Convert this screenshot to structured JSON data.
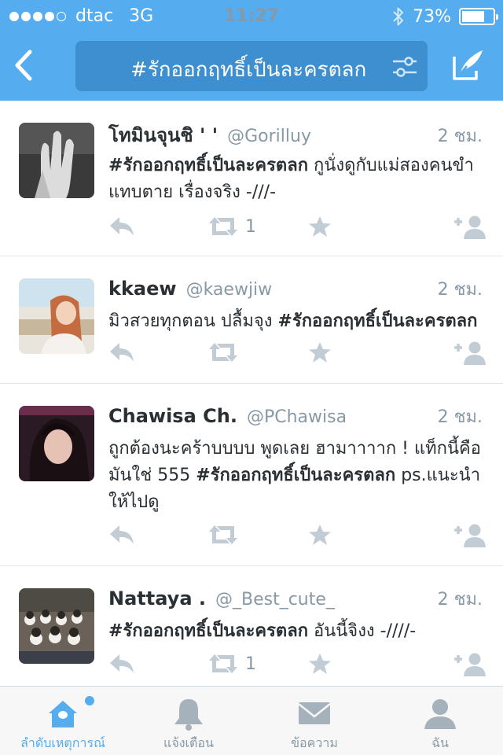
{
  "status_bar": {
    "carrier": "dtac",
    "network": "3G",
    "time": "11:27",
    "battery": "73%",
    "battery_level": 0.73,
    "signal_bars_filled": 4,
    "signal_bars_total": 5
  },
  "nav": {
    "search_query": "#รักออกฤทธิ์เป็นละครตลก",
    "back_icon": "chevron-left-icon",
    "filter_icon": "filter-sliders-icon",
    "compose_icon": "compose-tweet-icon"
  },
  "tweets": [
    {
      "name": "โทมินจุนชิ ' '",
      "handle": "@Gorilluy",
      "time": "2 ชม.",
      "hashtag": "#รักออกฤทธิ์เป็นละครตลก",
      "text_after": " กูนั่งดูกับแม่สองคนขำแทบตาย เรื่องจริง -///-",
      "retweets": "1"
    },
    {
      "name": "kkaew",
      "handle": "@kaewjiw",
      "time": "2 ชม.",
      "text_before": "มิวสวยทุกตอน ปลื้มจุง ",
      "hashtag": "#รักออกฤทธิ์เป็นละครตลก",
      "retweets": ""
    },
    {
      "name": "Chawisa Ch.",
      "handle": "@PChawisa",
      "time": "2 ชม.",
      "text_before": "ถูกต้องนะคร้าบบบบ พูดเลย ฮามาาาาก ! แท็กนี้คือมันใช่ 555 ",
      "hashtag": "#รักออกฤทธิ์เป็นละครตลก",
      "text_after": " ps.แนะนำให้ไปดู",
      "retweets": ""
    },
    {
      "name": "Nattaya .",
      "handle": "@_Best_cute_",
      "time": "2 ชม.",
      "hashtag": "#รักออกฤทธิ์เป็นละครตลก",
      "text_after": " อันนี้จิงง -////-",
      "retweets": "1"
    }
  ],
  "tabbar": {
    "home": "ลำดับเหตุการณ์",
    "notifications": "แจ้งเตือน",
    "messages": "ข้อความ",
    "me": "ฉัน"
  },
  "colors": {
    "accent": "#55acee",
    "muted": "#8899a6",
    "icon_gray": "#c1ccd5"
  }
}
